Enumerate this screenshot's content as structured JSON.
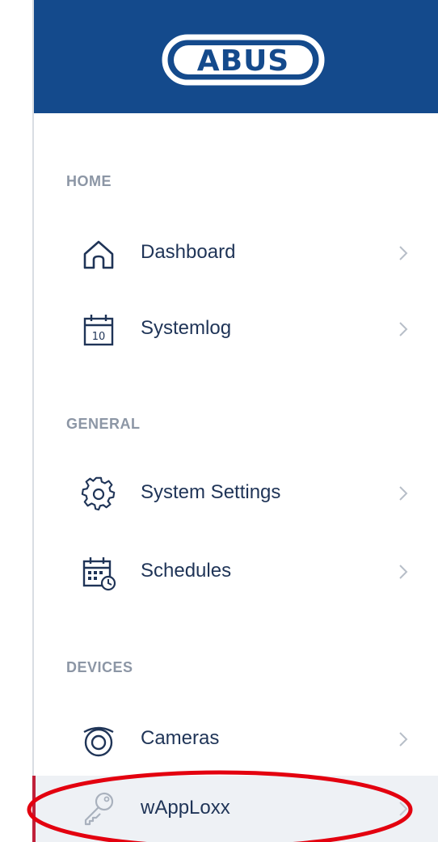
{
  "brand": {
    "logo_text": "ABUS",
    "bar_color": "#144a8c"
  },
  "sections": [
    {
      "label": "HOME",
      "items": [
        {
          "label": "Dashboard",
          "icon": "home-icon"
        },
        {
          "label": "Systemlog",
          "icon": "calendar-icon",
          "icon_text": "10"
        }
      ]
    },
    {
      "label": "GENERAL",
      "items": [
        {
          "label": "System Settings",
          "icon": "gear-icon"
        },
        {
          "label": "Schedules",
          "icon": "schedule-calendar-icon"
        }
      ]
    },
    {
      "label": "DEVICES",
      "items": [
        {
          "label": "Cameras",
          "icon": "camera-icon"
        },
        {
          "label": "wAppLoxx",
          "icon": "key-icon",
          "active": true
        }
      ]
    }
  ],
  "colors": {
    "accent_active": "#c0203a",
    "annotation_ellipse": "#e3000f",
    "text_primary": "#1f3457",
    "text_section": "#8c96a5"
  }
}
